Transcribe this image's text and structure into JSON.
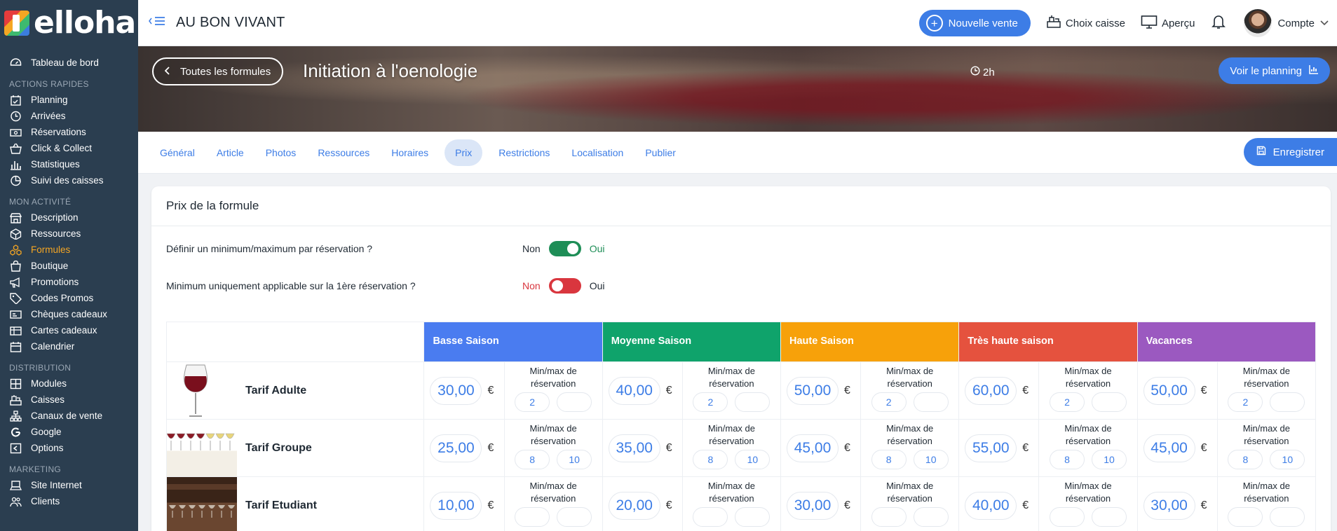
{
  "brand": {
    "name": "elloha"
  },
  "sidebar": {
    "top_item": {
      "label": "Tableau de bord",
      "icon": "dashboard-icon"
    },
    "sections": [
      {
        "title": "ACTIONS RAPIDES",
        "items": [
          {
            "label": "Planning",
            "icon": "calendar-check-icon"
          },
          {
            "label": "Arrivées",
            "icon": "clock-icon"
          },
          {
            "label": "Réservations",
            "icon": "money-icon"
          },
          {
            "label": "Click & Collect",
            "icon": "basket-icon"
          },
          {
            "label": "Statistiques",
            "icon": "bar-chart-icon"
          },
          {
            "label": "Suivi des caisses",
            "icon": "pie-chart-icon"
          }
        ]
      },
      {
        "title": "MON ACTIVITÉ",
        "items": [
          {
            "label": "Description",
            "icon": "store-icon"
          },
          {
            "label": "Ressources",
            "icon": "cube-icon"
          },
          {
            "label": "Formules",
            "icon": "cubes-icon",
            "active": true
          },
          {
            "label": "Boutique",
            "icon": "shopping-bag-icon"
          },
          {
            "label": "Promotions",
            "icon": "megaphone-icon"
          },
          {
            "label": "Codes Promos",
            "icon": "tag-icon"
          },
          {
            "label": "Chèques cadeaux",
            "icon": "voucher-icon"
          },
          {
            "label": "Cartes cadeaux",
            "icon": "gift-card-icon"
          },
          {
            "label": "Calendrier",
            "icon": "calendar-icon"
          }
        ]
      },
      {
        "title": "DISTRIBUTION",
        "items": [
          {
            "label": "Modules",
            "icon": "grid-icon"
          },
          {
            "label": "Caisses",
            "icon": "cash-register-icon"
          },
          {
            "label": "Canaux de vente",
            "icon": "network-icon"
          },
          {
            "label": "Google",
            "icon": "google-icon"
          },
          {
            "label": "Options",
            "icon": "options-icon"
          }
        ]
      },
      {
        "title": "MARKETING",
        "items": [
          {
            "label": "Site Internet",
            "icon": "laptop-icon"
          },
          {
            "label": "Clients",
            "icon": "users-icon"
          }
        ]
      }
    ]
  },
  "topbar": {
    "shop_name": "AU BON VIVANT",
    "new_sale": "Nouvelle vente",
    "choose_register": "Choix caisse",
    "preview": "Aperçu",
    "account": "Compte"
  },
  "banner": {
    "back_label": "Toutes les formules",
    "title": "Initiation à l'oenologie",
    "duration": "2h",
    "planning_label": "Voir le planning"
  },
  "tabs": {
    "items": [
      "Général",
      "Article",
      "Photos",
      "Ressources",
      "Horaires",
      "Prix",
      "Restrictions",
      "Localisation",
      "Publier"
    ],
    "active": "Prix",
    "save_label": "Enregistrer"
  },
  "card": {
    "title": "Prix de la formule",
    "options": [
      {
        "label": "Définir un minimum/maximum par réservation ?",
        "no": "Non",
        "yes": "Oui",
        "enabled": true
      },
      {
        "label": "Minimum uniquement applicable sur la 1ère réservation ?",
        "no": "Non",
        "yes": "Oui",
        "enabled": false
      }
    ]
  },
  "price_table": {
    "minmax_label": "Min/max de réservation",
    "currency": "€",
    "seasons": [
      {
        "name": "Basse Saison",
        "color": "#4a7cf0"
      },
      {
        "name": "Moyenne Saison",
        "color": "#0fa36b"
      },
      {
        "name": "Haute Saison",
        "color": "#f7a10a"
      },
      {
        "name": "Très haute saison",
        "color": "#e5523e"
      },
      {
        "name": "Vacances",
        "color": "#9b59c0"
      }
    ],
    "rows": [
      {
        "name": "Tarif Adulte",
        "prices": [
          {
            "price": "30,00",
            "min": "2",
            "max": ""
          },
          {
            "price": "40,00",
            "min": "2",
            "max": ""
          },
          {
            "price": "50,00",
            "min": "2",
            "max": ""
          },
          {
            "price": "60,00",
            "min": "2",
            "max": ""
          },
          {
            "price": "50,00",
            "min": "2",
            "max": ""
          }
        ]
      },
      {
        "name": "Tarif Groupe",
        "prices": [
          {
            "price": "25,00",
            "min": "8",
            "max": "10"
          },
          {
            "price": "35,00",
            "min": "8",
            "max": "10"
          },
          {
            "price": "45,00",
            "min": "8",
            "max": "10"
          },
          {
            "price": "55,00",
            "min": "8",
            "max": "10"
          },
          {
            "price": "45,00",
            "min": "8",
            "max": "10"
          }
        ]
      },
      {
        "name": "Tarif Etudiant",
        "prices": [
          {
            "price": "10,00",
            "min": "",
            "max": ""
          },
          {
            "price": "20,00",
            "min": "",
            "max": ""
          },
          {
            "price": "30,00",
            "min": "",
            "max": ""
          },
          {
            "price": "40,00",
            "min": "",
            "max": ""
          },
          {
            "price": "30,00",
            "min": "",
            "max": ""
          }
        ]
      }
    ]
  }
}
